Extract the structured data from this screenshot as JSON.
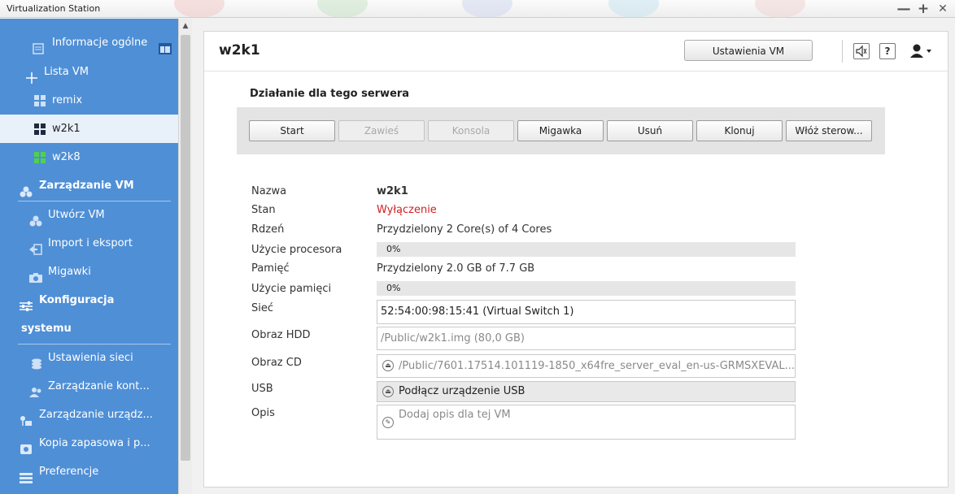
{
  "window": {
    "title": "Virtualization Station",
    "controls": {
      "minimize": "—",
      "maximize": "+",
      "close": "✕"
    }
  },
  "sidebar": {
    "items": [
      {
        "label": "Informacje ogólne",
        "icon": "info-icon"
      },
      {
        "label": "Lista VM",
        "icon": "plus-icon"
      },
      {
        "label": "remix",
        "icon": "vm-icon"
      },
      {
        "label": "w2k1",
        "icon": "vm-icon",
        "selected": true
      },
      {
        "label": "w2k8",
        "icon": "vm-running-icon"
      },
      {
        "label": "Zarządzanie VM",
        "icon": "vm-manage-icon"
      },
      {
        "label": "Utwórz VM",
        "icon": "create-vm-icon"
      },
      {
        "label": "Import i eksport",
        "icon": "import-icon"
      },
      {
        "label": "Migawki",
        "icon": "camera-icon"
      },
      {
        "label": "Konfiguracja",
        "icon": "sliders-icon"
      },
      {
        "label": "systemu"
      },
      {
        "label": "Ustawienia sieci",
        "icon": "network-icon"
      },
      {
        "label": "Zarządzanie kont...",
        "icon": "accounts-icon"
      },
      {
        "label": "Zarządzanie urządz...",
        "icon": "devices-icon"
      },
      {
        "label": "Kopia zapasowa i p...",
        "icon": "backup-icon"
      },
      {
        "label": "Preferencje",
        "icon": "preferences-icon"
      }
    ],
    "colors": {
      "background": "#4f8fd6",
      "selected": "#e8f0fa"
    }
  },
  "header": {
    "vm_name": "w2k1",
    "settings_button": "Ustawienia VM",
    "help_icon_label": "?",
    "icons": [
      "speaker-icon",
      "help-icon",
      "user-icon"
    ]
  },
  "actions": {
    "title": "Działanie dla tego serwera",
    "buttons": [
      {
        "label": "Start",
        "enabled": true
      },
      {
        "label": "Zawieś",
        "enabled": false
      },
      {
        "label": "Konsola",
        "enabled": false
      },
      {
        "label": "Migawka",
        "enabled": true
      },
      {
        "label": "Usuń",
        "enabled": true
      },
      {
        "label": "Klonuj",
        "enabled": true
      },
      {
        "label": "Włóż sterow...",
        "enabled": true
      }
    ]
  },
  "details": {
    "name": {
      "label": "Nazwa",
      "value": "w2k1"
    },
    "state": {
      "label": "Stan",
      "value": "Wyłączenie",
      "color": "#d21f1f"
    },
    "core": {
      "label": "Rdzeń",
      "value": "Przydzielony 2 Core(s) of 4 Cores"
    },
    "cpu": {
      "label": "Użycie procesora",
      "value_text": "0%",
      "value": 0
    },
    "memory": {
      "label": "Pamięć",
      "value": "Przydzielony 2.0 GB of 7.7 GB"
    },
    "memory_usage": {
      "label": "Użycie pamięci",
      "value_text": "0%",
      "value": 0
    },
    "network": {
      "label": "Sieć",
      "value": "52:54:00:98:15:41 (Virtual Switch 1)"
    },
    "hdd": {
      "label": "Obraz HDD",
      "value": "/Public/w2k1.img (80,0 GB)"
    },
    "cd": {
      "label": "Obraz CD",
      "value": "/Public/7601.17514.101119-1850_x64fre_server_eval_en-us-GRMSXEVAL..."
    },
    "usb": {
      "label": "USB",
      "value": "Podłącz urządzenie USB"
    },
    "description": {
      "label": "Opis",
      "placeholder": "Dodaj opis dla tej VM"
    }
  }
}
